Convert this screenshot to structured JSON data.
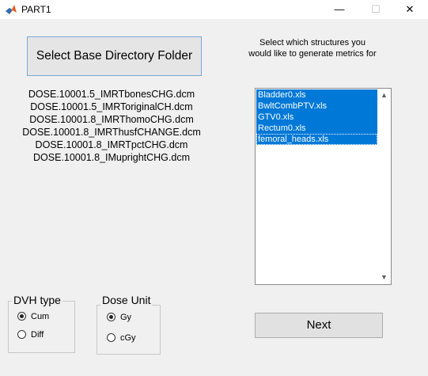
{
  "window": {
    "title": "PART1",
    "minimize_glyph": "—",
    "maximize_glyph": "☐",
    "close_glyph": "✕"
  },
  "select_button": {
    "label": "Select Base Directory Folder"
  },
  "files": [
    "DOSE.10001.5_IMRTbonesCHG.dcm",
    "DOSE.10001.5_IMRToriginalCH.dcm",
    "DOSE.10001.8_IMRThomoCHG.dcm",
    "DOSE.10001.8_IMRThusfCHANGE.dcm",
    "DOSE.10001.8_IMRTpctCHG.dcm",
    "DOSE.10001.8_IMuprightCHG.dcm"
  ],
  "instructions": {
    "line1": "Select which structures you",
    "line2": "would like to generate metrics for"
  },
  "structures": [
    {
      "label": "Bladder0.xls",
      "selected": true
    },
    {
      "label": "BwltCombPTV.xls",
      "selected": true
    },
    {
      "label": "GTV0.xls",
      "selected": true
    },
    {
      "label": "Rectum0.xls",
      "selected": true
    },
    {
      "label": "femoral_heads.xls",
      "selected": true
    }
  ],
  "scroll": {
    "up_glyph": "▲",
    "down_glyph": "▼"
  },
  "dvh_type": {
    "title": "DVH type",
    "options": [
      {
        "label": "Cum",
        "checked": true
      },
      {
        "label": "Diff",
        "checked": false
      }
    ]
  },
  "dose_unit": {
    "title": "Dose Unit",
    "options": [
      {
        "label": "Gy",
        "checked": true
      },
      {
        "label": "cGy",
        "checked": false
      }
    ]
  },
  "next_button": {
    "label": "Next"
  },
  "colors": {
    "selection": "#0078d7",
    "window_bg": "#f0f0f0"
  },
  "icons": {
    "app": "matlab-icon"
  }
}
